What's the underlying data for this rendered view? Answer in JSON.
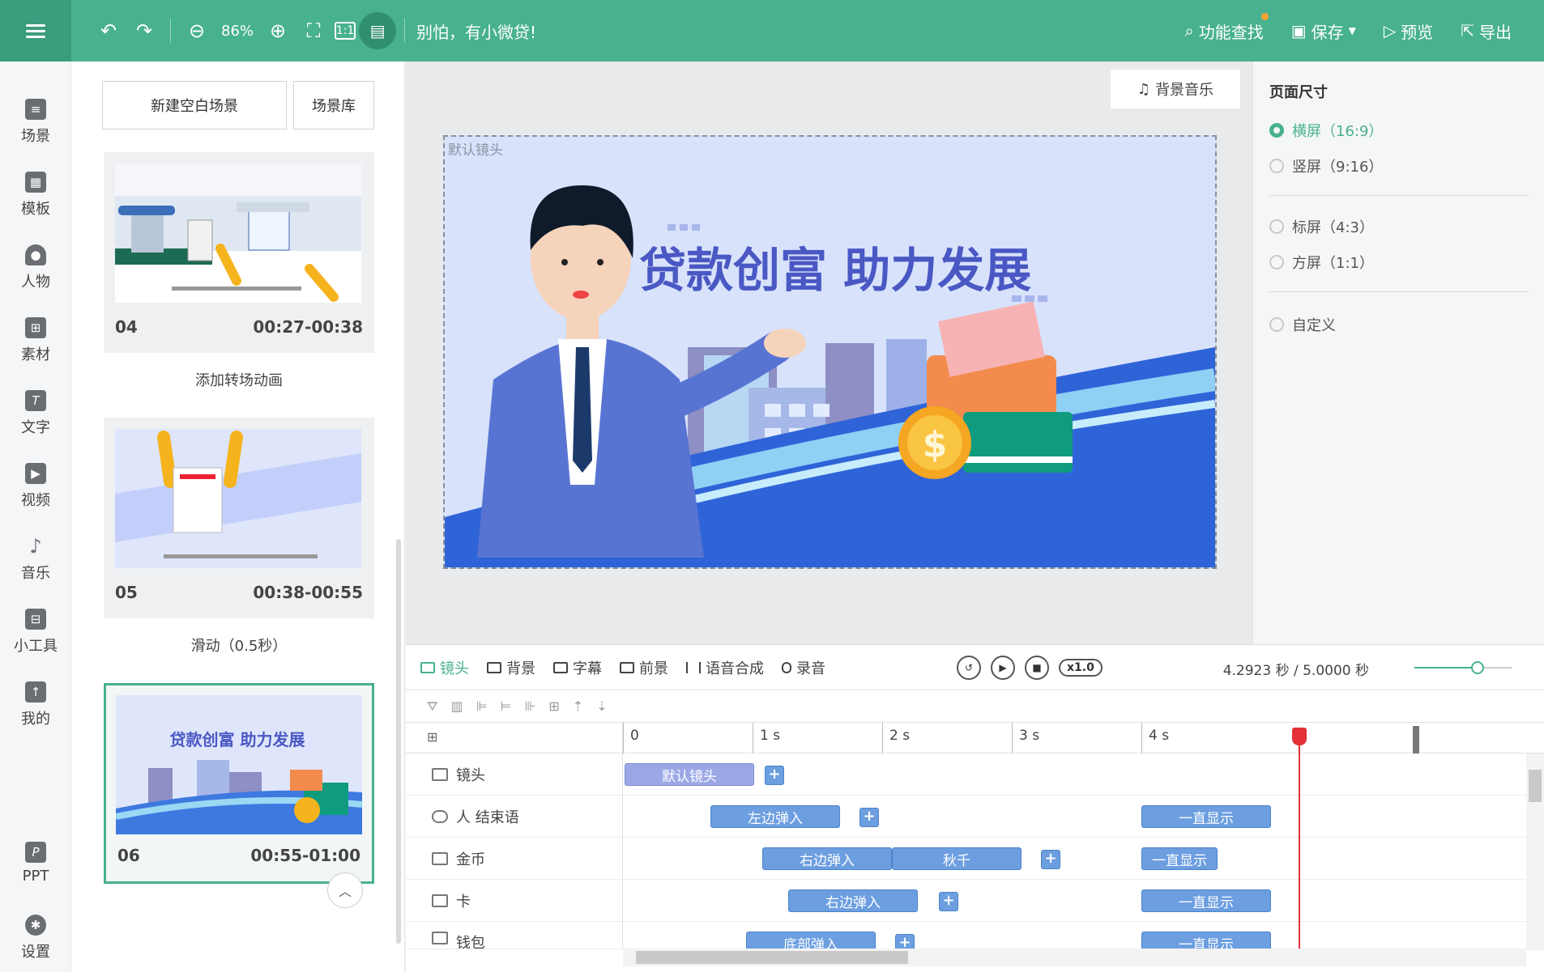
{
  "topbar": {
    "zoom": "86%",
    "slogan": "别怕，有小微贷!",
    "find_label": "功能查找",
    "save_label": "保存",
    "preview_label": "预览",
    "export_label": "导出"
  },
  "leftnav": {
    "items": [
      {
        "label": "场景",
        "icon": "scene-icon"
      },
      {
        "label": "模板",
        "icon": "template-icon"
      },
      {
        "label": "人物",
        "icon": "person-icon"
      },
      {
        "label": "素材",
        "icon": "material-icon"
      },
      {
        "label": "文字",
        "icon": "text-icon"
      },
      {
        "label": "视频",
        "icon": "video-icon"
      },
      {
        "label": "音乐",
        "icon": "music-icon"
      },
      {
        "label": "小工具",
        "icon": "toolbox-icon"
      },
      {
        "label": "我的",
        "icon": "upload-icon"
      },
      {
        "label": "PPT",
        "icon": "ppt-icon"
      },
      {
        "label": "设置",
        "icon": "settings-icon"
      }
    ]
  },
  "scenes": {
    "new_label": "新建空白场景",
    "library_label": "场景库",
    "cards": [
      {
        "num": "04",
        "time": "00:27-00:38"
      },
      {
        "num": "05",
        "time": "00:38-00:55"
      },
      {
        "num": "06",
        "time": "00:55-01:00"
      }
    ],
    "transitions": [
      "添加转场动画",
      "滑动（0.5秒）"
    ]
  },
  "canvas": {
    "bgm_label": "背景音乐",
    "stage_label": "默认镜头",
    "banner_text": "贷款创富  助力发展"
  },
  "props": {
    "title": "页面尺寸",
    "options": [
      {
        "label": "横屏（16:9）",
        "selected": true
      },
      {
        "label": "竖屏（9:16）",
        "selected": false
      },
      {
        "label": "标屏（4:3）",
        "selected": false
      },
      {
        "label": "方屏（1:1）",
        "selected": false
      },
      {
        "label": "自定义",
        "selected": false
      }
    ]
  },
  "timeline": {
    "tabs": [
      "镜头",
      "背景",
      "字幕",
      "前景",
      "语音合成",
      "录音"
    ],
    "speed": "x1.0",
    "time_readout": "4.2923 秒 / 5.0000 秒",
    "volume": 0.65,
    "ruler": [
      "0",
      "1 s",
      "2 s",
      "3 s",
      "4 s"
    ],
    "tracks": [
      {
        "label": "镜头",
        "clips": [
          "默认镜头"
        ]
      },
      {
        "label": "人 结束语",
        "clips": [
          "左边弹入",
          "一直显示"
        ]
      },
      {
        "label": "金币",
        "clips": [
          "右边弹入",
          "秋千",
          "一直显示"
        ]
      },
      {
        "label": "卡",
        "clips": [
          "右边弹入",
          "一直显示"
        ]
      },
      {
        "label": "钱包",
        "clips": [
          "底部弹入",
          "一直显示"
        ]
      }
    ]
  },
  "colors": {
    "accent": "#48b190",
    "clip": "#6c9ee0",
    "playhead": "#e5303a"
  }
}
